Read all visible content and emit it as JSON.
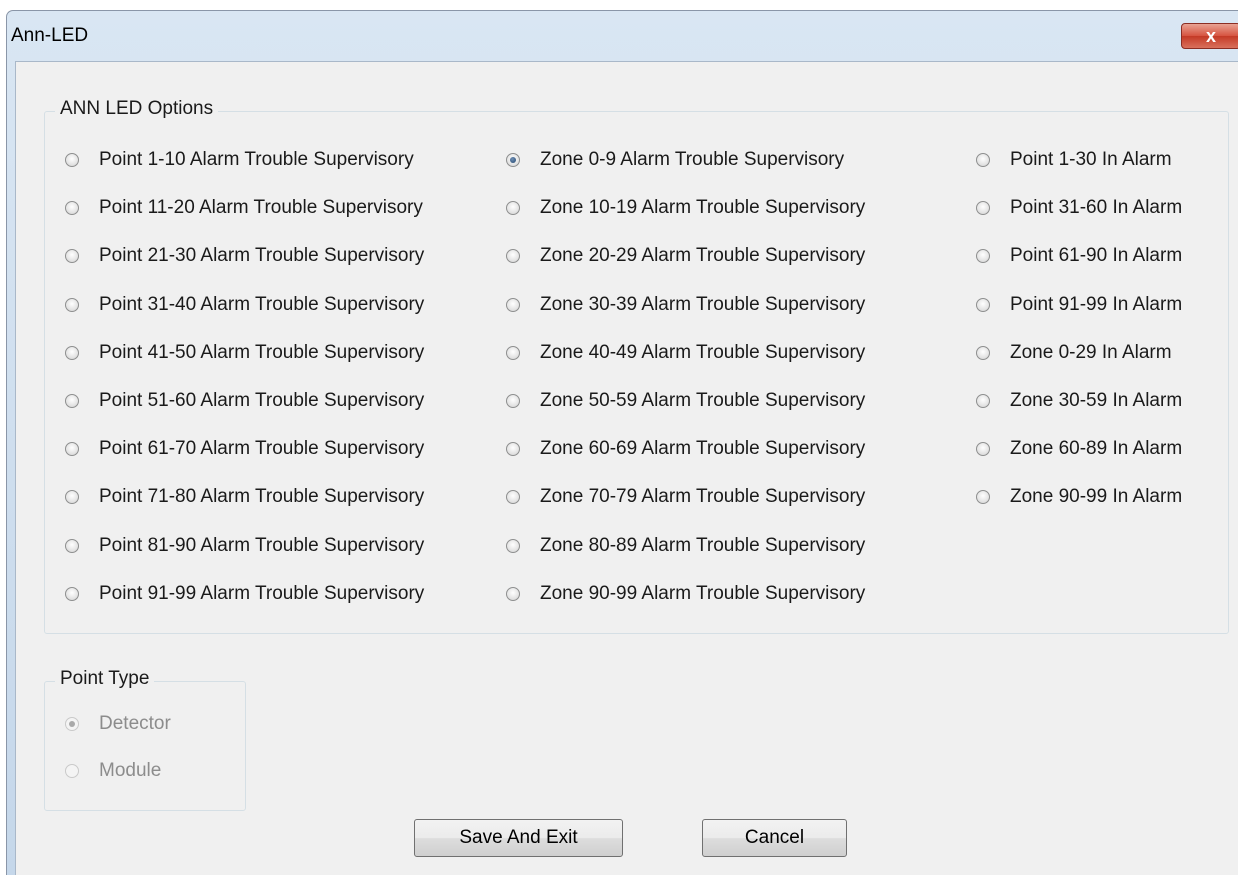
{
  "window": {
    "title": "Ann-LED",
    "close_label": "x"
  },
  "ann_led_options": {
    "legend": "ANN LED Options",
    "columns": [
      [
        {
          "label": "Point 1-10 Alarm Trouble Supervisory",
          "checked": false
        },
        {
          "label": "Point 11-20 Alarm Trouble Supervisory",
          "checked": false
        },
        {
          "label": "Point 21-30 Alarm Trouble Supervisory",
          "checked": false
        },
        {
          "label": "Point 31-40 Alarm Trouble Supervisory",
          "checked": false
        },
        {
          "label": "Point 41-50 Alarm Trouble Supervisory",
          "checked": false
        },
        {
          "label": "Point 51-60 Alarm Trouble Supervisory",
          "checked": false
        },
        {
          "label": "Point 61-70 Alarm Trouble Supervisory",
          "checked": false
        },
        {
          "label": "Point 71-80 Alarm Trouble Supervisory",
          "checked": false
        },
        {
          "label": "Point 81-90 Alarm Trouble Supervisory",
          "checked": false
        },
        {
          "label": "Point 91-99 Alarm Trouble Supervisory",
          "checked": false
        }
      ],
      [
        {
          "label": "Zone 0-9 Alarm Trouble Supervisory",
          "checked": true
        },
        {
          "label": "Zone 10-19 Alarm Trouble Supervisory",
          "checked": false
        },
        {
          "label": "Zone 20-29 Alarm Trouble Supervisory",
          "checked": false
        },
        {
          "label": "Zone 30-39 Alarm Trouble Supervisory",
          "checked": false
        },
        {
          "label": "Zone 40-49 Alarm Trouble Supervisory",
          "checked": false
        },
        {
          "label": "Zone 50-59 Alarm Trouble Supervisory",
          "checked": false
        },
        {
          "label": "Zone 60-69 Alarm Trouble Supervisory",
          "checked": false
        },
        {
          "label": "Zone 70-79 Alarm Trouble Supervisory",
          "checked": false
        },
        {
          "label": "Zone 80-89 Alarm Trouble Supervisory",
          "checked": false
        },
        {
          "label": "Zone 90-99 Alarm Trouble Supervisory",
          "checked": false
        }
      ],
      [
        {
          "label": "Point 1-30 In Alarm",
          "checked": false
        },
        {
          "label": "Point 31-60 In Alarm",
          "checked": false
        },
        {
          "label": "Point 61-90 In Alarm",
          "checked": false
        },
        {
          "label": "Point 91-99 In Alarm",
          "checked": false
        },
        {
          "label": "Zone 0-29 In Alarm",
          "checked": false
        },
        {
          "label": "Zone 30-59 In Alarm",
          "checked": false
        },
        {
          "label": "Zone 60-89 In Alarm",
          "checked": false
        },
        {
          "label": "Zone 90-99 In Alarm",
          "checked": false
        }
      ]
    ]
  },
  "point_type": {
    "legend": "Point Type",
    "options": [
      {
        "label": "Detector",
        "checked": true,
        "enabled": false
      },
      {
        "label": "Module",
        "checked": false,
        "enabled": false
      }
    ]
  },
  "buttons": {
    "save": "Save And Exit",
    "cancel": "Cancel"
  }
}
